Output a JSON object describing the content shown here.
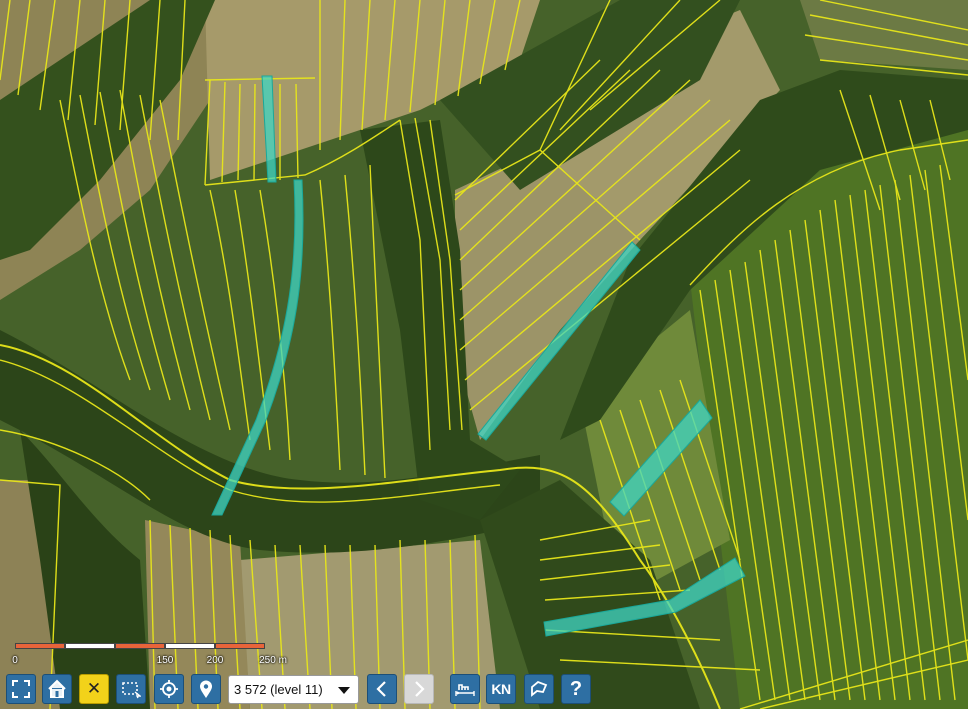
{
  "map": {
    "colors": {
      "parcel_line": "#e8e61a",
      "highlight_fill": "#3fd6c4",
      "forest": "#2f4a1c",
      "field_tan": "#9a8c5c",
      "field_green": "#5a7f2a"
    }
  },
  "scale": {
    "labels": [
      "0",
      "150",
      "200",
      "250 m"
    ],
    "colors": [
      "#e8643a",
      "#ffffff"
    ]
  },
  "toolbar": {
    "zoom_value": "3 572 (level 11)",
    "icons": {
      "fullscreen": "fullscreen-icon",
      "home": "home-icon",
      "close": "close-icon",
      "select": "select-area-icon",
      "locate": "locate-icon",
      "marker": "map-marker-icon",
      "back": "chevron-left-icon",
      "forward": "chevron-right-icon",
      "measure": "measure-icon",
      "cadastre": "kn-icon",
      "shape": "draw-shape-icon",
      "help": "help-icon"
    },
    "kn_label": "KN",
    "help_label": "?",
    "close_label": "✕"
  }
}
